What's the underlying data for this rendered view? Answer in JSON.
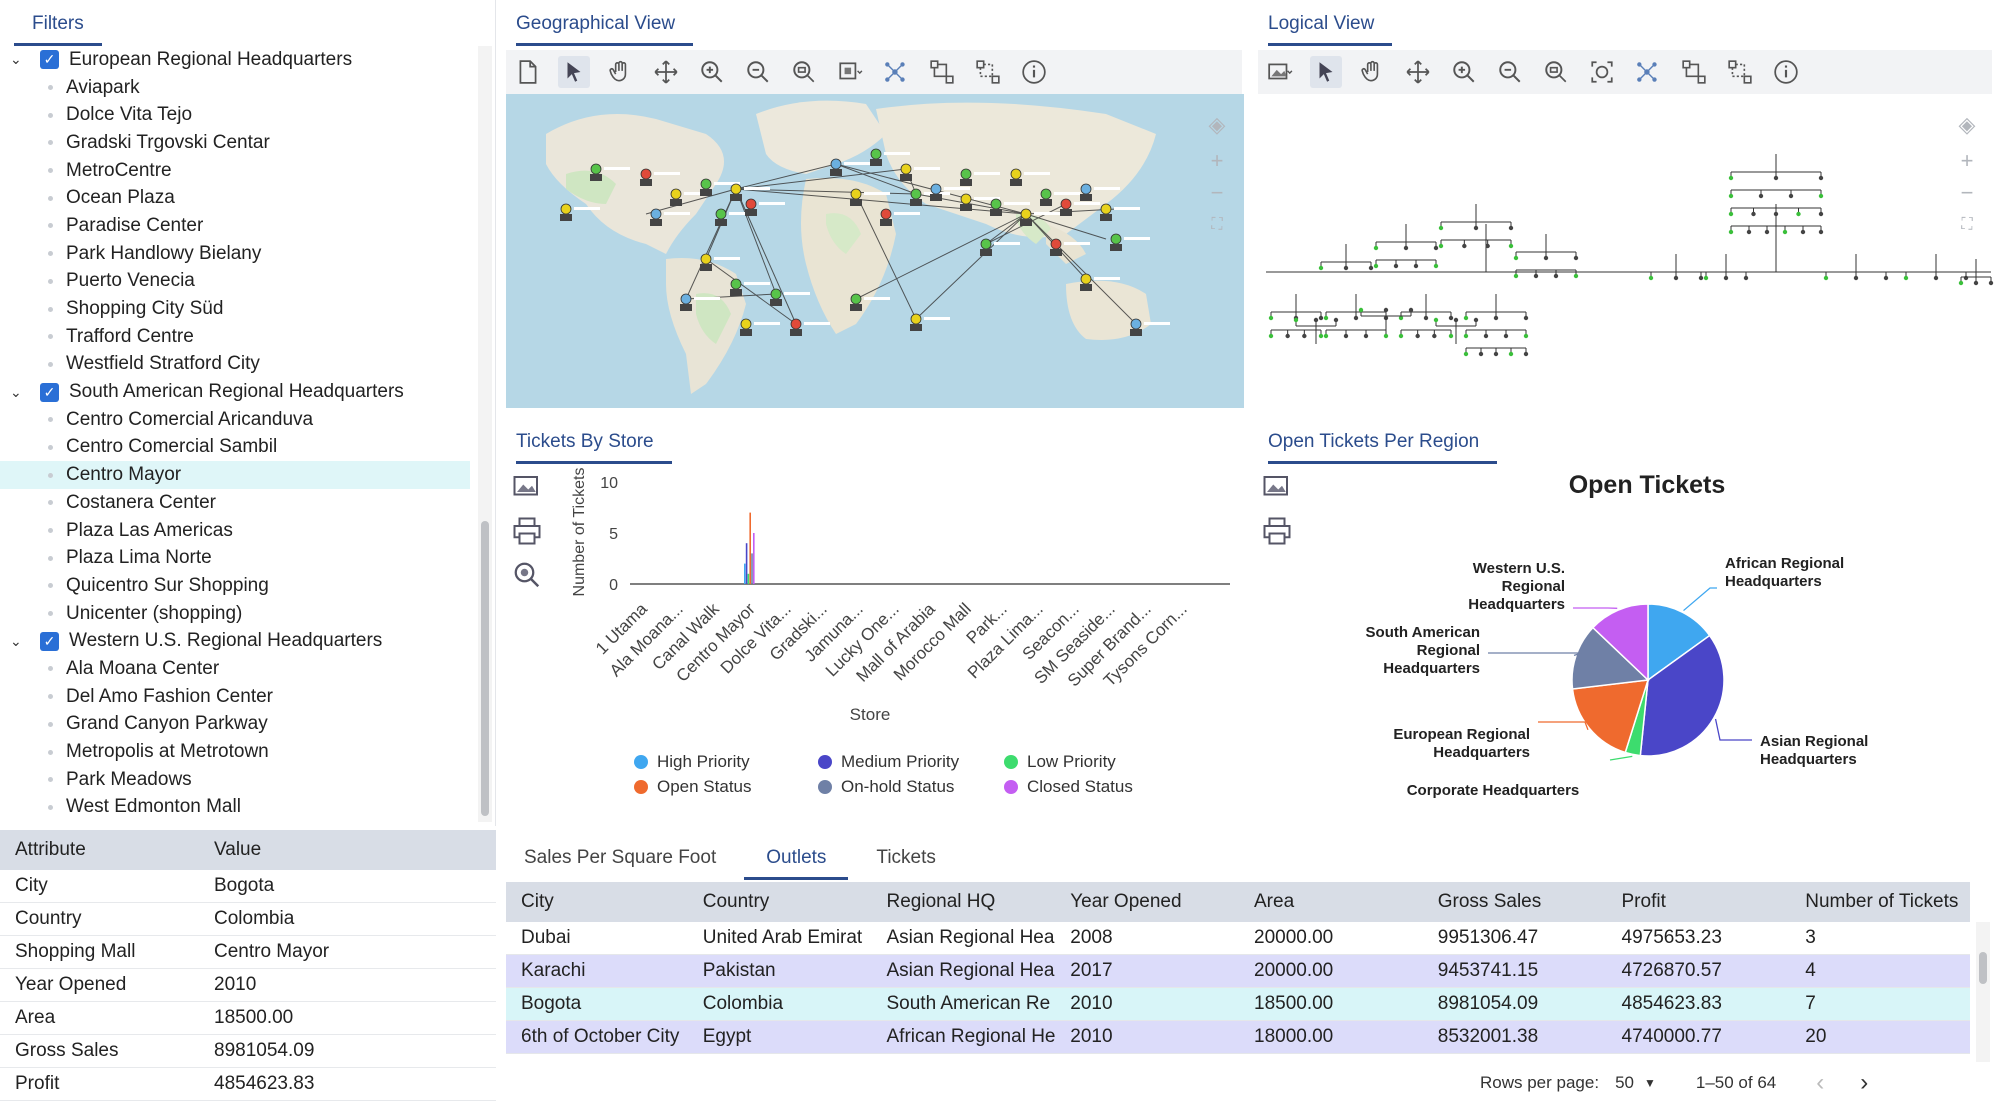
{
  "filters": {
    "tab": "Filters",
    "tree": [
      {
        "type": "group",
        "label": "European Regional Headquarters"
      },
      {
        "type": "leaf",
        "label": "Aviapark"
      },
      {
        "type": "leaf",
        "label": "Dolce Vita Tejo"
      },
      {
        "type": "leaf",
        "label": "Gradski Trgovski Centar"
      },
      {
        "type": "leaf",
        "label": "MetroCentre"
      },
      {
        "type": "leaf",
        "label": "Ocean Plaza"
      },
      {
        "type": "leaf",
        "label": "Paradise Center"
      },
      {
        "type": "leaf",
        "label": "Park Handlowy Bielany"
      },
      {
        "type": "leaf",
        "label": "Puerto Venecia"
      },
      {
        "type": "leaf",
        "label": "Shopping City Süd"
      },
      {
        "type": "leaf",
        "label": "Trafford Centre"
      },
      {
        "type": "leaf",
        "label": "Westfield Stratford City"
      },
      {
        "type": "group",
        "label": "South American Regional Headquarters"
      },
      {
        "type": "leaf",
        "label": "Centro Comercial Aricanduva"
      },
      {
        "type": "leaf",
        "label": "Centro Comercial Sambil"
      },
      {
        "type": "leaf",
        "label": "Centro Mayor",
        "selected": true
      },
      {
        "type": "leaf",
        "label": "Costanera Center"
      },
      {
        "type": "leaf",
        "label": "Plaza Las Americas"
      },
      {
        "type": "leaf",
        "label": "Plaza Lima Norte"
      },
      {
        "type": "leaf",
        "label": "Quicentro Sur Shopping"
      },
      {
        "type": "leaf",
        "label": "Unicenter (shopping)"
      },
      {
        "type": "group",
        "label": "Western U.S. Regional Headquarters"
      },
      {
        "type": "leaf",
        "label": "Ala Moana Center"
      },
      {
        "type": "leaf",
        "label": "Del Amo Fashion Center"
      },
      {
        "type": "leaf",
        "label": "Grand Canyon Parkway"
      },
      {
        "type": "leaf",
        "label": "Metropolis at Metrotown"
      },
      {
        "type": "leaf",
        "label": "Park Meadows"
      },
      {
        "type": "leaf",
        "label": "West Edmonton Mall"
      }
    ]
  },
  "attributes": {
    "header": [
      "Attribute",
      "Value"
    ],
    "rows": [
      [
        "City",
        "Bogota"
      ],
      [
        "Country",
        "Colombia"
      ],
      [
        "Shopping Mall",
        "Centro Mayor"
      ],
      [
        "Year Opened",
        "2010"
      ],
      [
        "Area",
        "18500.00"
      ],
      [
        "Gross Sales",
        "8981054.09"
      ],
      [
        "Profit",
        "4854623.83"
      ]
    ]
  },
  "geo": {
    "tab": "Geographical View"
  },
  "logical": {
    "tab": "Logical View"
  },
  "tickets_tab": "Tickets By Store",
  "region_tab": "Open Tickets Per Region",
  "chart_data": [
    {
      "type": "bar",
      "ylabel": "Number of Tickets",
      "xlabel": "Store",
      "ylim": [
        0,
        10
      ],
      "yticks": [
        "0",
        "5",
        "10"
      ],
      "categories": [
        "1 Utama",
        "Ala Moana...",
        "Canal Walk",
        "Centro Mayor",
        "Dolce Vita...",
        "Gradski...",
        "Jamuna...",
        "Lucky One...",
        "Mall of Arabia",
        "Morocco Mall",
        "Park...",
        "Plaza Lima...",
        "Seacon...",
        "SM Seaside...",
        "Super Brand...",
        "Tysons Corn..."
      ],
      "series": [
        {
          "name": "High Priority",
          "color": "#3fa7f0",
          "values": [
            0,
            0,
            0,
            2,
            0,
            0,
            0,
            0,
            0,
            0,
            0,
            0,
            0,
            0,
            0,
            0
          ]
        },
        {
          "name": "Medium Priority",
          "color": "#4a46c8",
          "values": [
            0,
            0,
            0,
            4,
            0,
            0,
            0,
            0,
            0,
            0,
            0,
            0,
            0,
            0,
            0,
            0
          ]
        },
        {
          "name": "Low Priority",
          "color": "#3ddc6e",
          "values": [
            0,
            0,
            0,
            1,
            0,
            0,
            0,
            0,
            0,
            0,
            0,
            0,
            0,
            0,
            0,
            0
          ]
        },
        {
          "name": "Open Status",
          "color": "#ef6a2e",
          "values": [
            0,
            0,
            0,
            7,
            0,
            0,
            0,
            0,
            0,
            0,
            0,
            0,
            0,
            0,
            0,
            0
          ]
        },
        {
          "name": "On-hold Status",
          "color": "#6f80a6",
          "values": [
            0,
            0,
            0,
            3,
            0,
            0,
            0,
            0,
            0,
            0,
            0,
            0,
            0,
            0,
            0,
            0
          ]
        },
        {
          "name": "Closed Status",
          "color": "#c45ef2",
          "values": [
            0,
            0,
            0,
            5,
            0,
            0,
            0,
            0,
            0,
            0,
            0,
            0,
            0,
            0,
            0,
            0
          ]
        }
      ],
      "legend": "bottom"
    },
    {
      "type": "pie",
      "title": "Open Tickets",
      "slices": [
        {
          "label": "African Regional Headquarters",
          "value": 14,
          "color": "#3fa7f0"
        },
        {
          "label": "Asian Regional Headquarters",
          "value": 34,
          "color": "#4a46c8"
        },
        {
          "label": "Corporate Headquarters",
          "value": 3,
          "color": "#3ddc6e"
        },
        {
          "label": "European Regional Headquarters",
          "value": 17,
          "color": "#ef6a2e"
        },
        {
          "label": "South American Regional Headquarters",
          "value": 13,
          "color": "#6f80a6"
        },
        {
          "label": "Western U.S. Regional Headquarters",
          "value": 12,
          "color": "#c45ef2"
        }
      ]
    }
  ],
  "bottom_tabs": [
    "Sales Per Square Foot",
    "Outlets",
    "Tickets"
  ],
  "outlets": {
    "columns": [
      "City",
      "Country",
      "Regional HQ",
      "Year Opened",
      "Area",
      "Gross Sales",
      "Profit",
      "Number of Tickets"
    ],
    "rows": [
      [
        "Dubai",
        "United Arab Emirat",
        "Asian Regional Hea",
        "2008",
        "20000.00",
        "9951306.47",
        "4975653.23",
        "3"
      ],
      [
        "Karachi",
        "Pakistan",
        "Asian Regional Hea",
        "2017",
        "20000.00",
        "9453741.15",
        "4726870.57",
        "4"
      ],
      [
        "Bogota",
        "Colombia",
        "South American Re",
        "2010",
        "18500.00",
        "8981054.09",
        "4854623.83",
        "7"
      ],
      [
        "6th of October City",
        "Egypt",
        "African Regional He",
        "2010",
        "18000.00",
        "8532001.38",
        "4740000.77",
        "20"
      ]
    ],
    "rows_per_page_label": "Rows per page:",
    "rows_per_page": "50",
    "range": "1–50 of 64"
  }
}
